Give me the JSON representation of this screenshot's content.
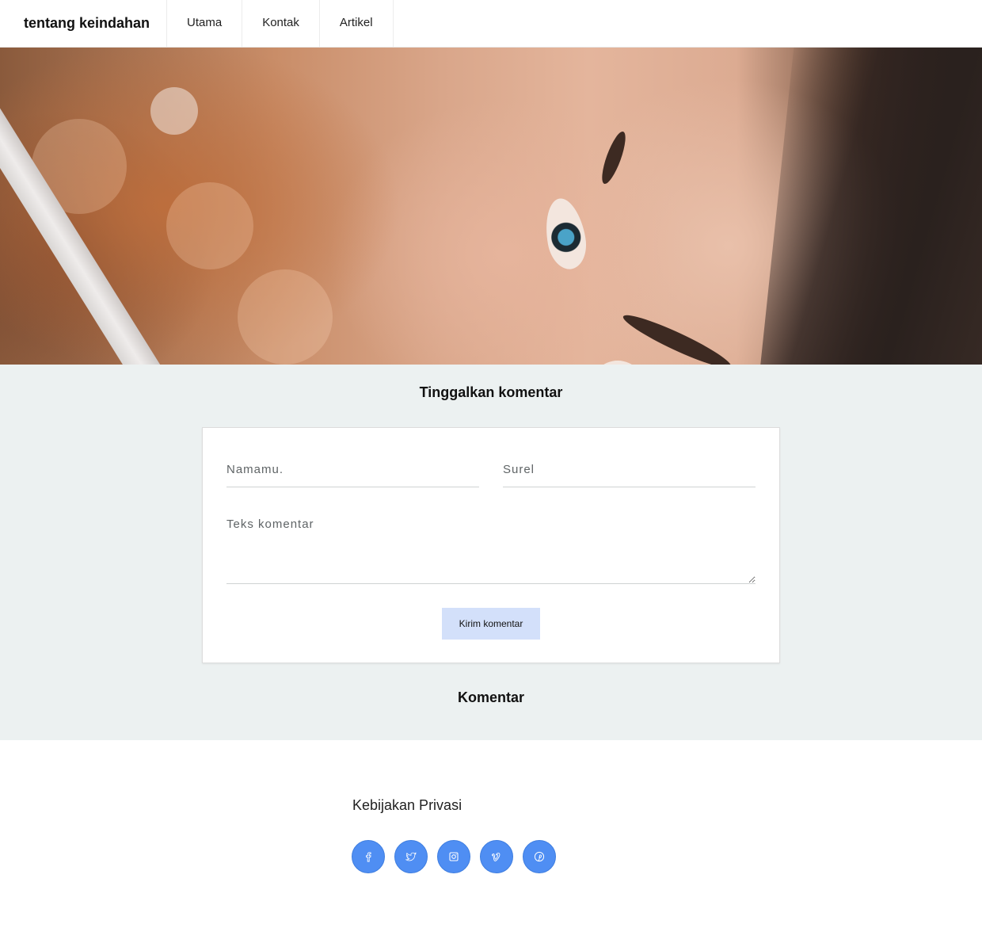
{
  "header": {
    "brand": "tentang keindahan",
    "nav": [
      {
        "label": "Utama"
      },
      {
        "label": "Kontak"
      },
      {
        "label": "Artikel"
      }
    ]
  },
  "hero": {
    "image": "close-up portrait of woman with blue eyes"
  },
  "comment_form": {
    "title": "Tinggalkan komentar",
    "name_placeholder": "Namamu.",
    "email_placeholder": "Surel",
    "text_placeholder": "Teks komentar",
    "submit_label": "Kirim komentar"
  },
  "comments": {
    "title": "Komentar"
  },
  "footer": {
    "privacy_label": "Kebijakan Privasi",
    "social": [
      {
        "icon": "facebook-icon"
      },
      {
        "icon": "twitter-icon"
      },
      {
        "icon": "instagram-icon"
      },
      {
        "icon": "vimeo-icon"
      },
      {
        "icon": "pinterest-icon"
      }
    ]
  },
  "colors": {
    "section_bg": "#ecf1f1",
    "button_bg": "#d3e0fa",
    "social_bg": "#4f8ef3"
  }
}
